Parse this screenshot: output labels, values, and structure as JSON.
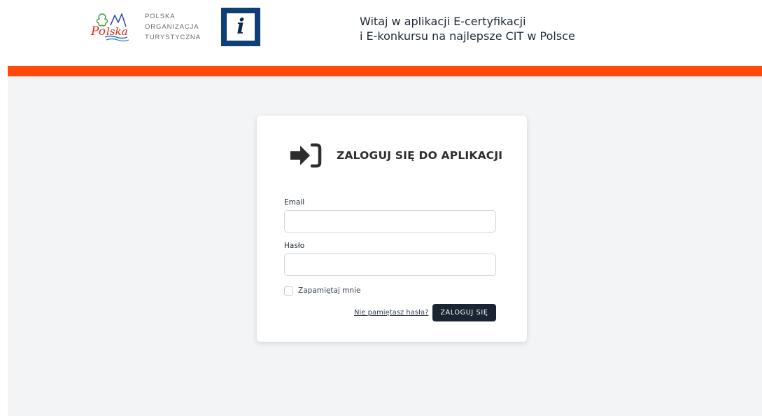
{
  "header": {
    "logo": {
      "mark_text": "Polska",
      "org_lines": [
        "POLSKA",
        "ORGANIZACJA",
        "TURYSTYCZNA"
      ]
    },
    "info_logo": {
      "letter": "i"
    },
    "welcome_lines": [
      "Witaj w aplikacji E-certyfikacji",
      "i E-konkursu na najlepsze CIT w Polsce"
    ]
  },
  "colors": {
    "accent_bar": "#ff4a09",
    "info_logo_blue": "#0e3f7a",
    "button_dark": "#1b2433",
    "page_background": "#f3f4f6"
  },
  "login": {
    "icon": "sign-in-icon",
    "title": "ZALOGUJ SIĘ DO APLIKACJI",
    "email_label": "Email",
    "email_value": "",
    "password_label": "Hasło",
    "password_value": "",
    "remember_label": "Zapamiętaj mnie",
    "remember_checked": false,
    "forgot_link": "Nie pamiętasz hasła?",
    "submit_label": "ZALOGUJ SIĘ"
  }
}
